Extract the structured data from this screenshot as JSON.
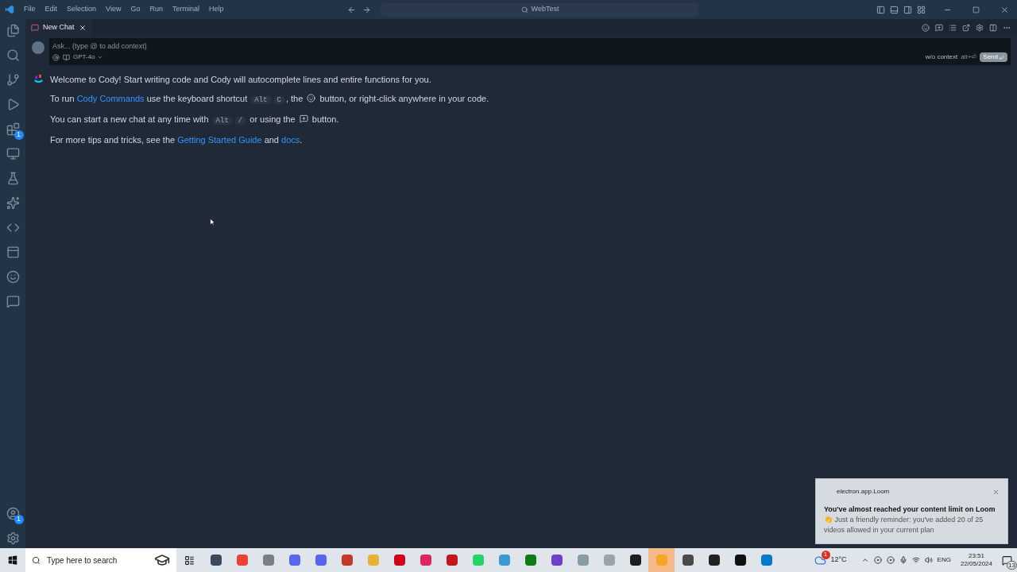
{
  "menu": [
    "File",
    "Edit",
    "Selection",
    "View",
    "Go",
    "Run",
    "Terminal",
    "Help"
  ],
  "command_center": {
    "placeholder": "WebTest"
  },
  "activity_bar": {
    "extensions_badge": "1",
    "accounts_badge": "1"
  },
  "tabs": [
    {
      "label": "New Chat",
      "selected": true
    }
  ],
  "chat_input": {
    "placeholder": "Ask... (type @ to add context)",
    "model": "GPT-4o",
    "context_hint": "w/o context",
    "shortcut": "alt+⏎",
    "send": "Send"
  },
  "messages": [
    {
      "segments": [
        {
          "kind": "text",
          "text": "Welcome to Cody! Start writing code and Cody will autocomplete lines and entire functions for you."
        }
      ]
    },
    {
      "segments": [
        {
          "kind": "text",
          "text": "To run "
        },
        {
          "kind": "link",
          "text": "Cody Commands"
        },
        {
          "kind": "text",
          "text": " use the keyboard shortcut "
        },
        {
          "kind": "key",
          "text": "Alt"
        },
        {
          "kind": "key",
          "text": "C"
        },
        {
          "kind": "text",
          "text": ", the "
        },
        {
          "kind": "icon"
        },
        {
          "kind": "text",
          "text": " button, or right-click anywhere in your code."
        }
      ]
    },
    {
      "segments": [
        {
          "kind": "text",
          "text": "You can start a new chat at any time with "
        },
        {
          "kind": "key",
          "text": "Alt"
        },
        {
          "kind": "key",
          "text": "/"
        },
        {
          "kind": "text",
          "text": " or using the "
        },
        {
          "kind": "icon"
        },
        {
          "kind": "text",
          "text": " button."
        }
      ]
    },
    {
      "segments": [
        {
          "kind": "text",
          "text": "For more tips and tricks, see the "
        },
        {
          "kind": "link",
          "text": "Getting Started Guide"
        },
        {
          "kind": "text",
          "text": " and "
        },
        {
          "kind": "link",
          "text": "docs"
        },
        {
          "kind": "text",
          "text": "."
        }
      ]
    }
  ],
  "notification": {
    "app": "electron.app.Loom",
    "title": "You've almost reached your content limit on Loom",
    "body": "👏 Just a friendly reminder: you've added 20 of 25 videos allowed in your current plan"
  },
  "taskbar": {
    "search_placeholder": "Type here to search",
    "apps": [
      {
        "color": "#3b4a5a",
        "active": false
      },
      {
        "color": "#ea4335",
        "active": false
      },
      {
        "color": "#7a7f86",
        "active": false
      },
      {
        "color": "#5865f2",
        "active": false
      },
      {
        "color": "#5865f2",
        "active": false
      },
      {
        "color": "#c0392b",
        "active": false
      },
      {
        "color": "#e8b13a",
        "active": false
      },
      {
        "color": "#d0021b",
        "active": false
      },
      {
        "color": "#e0245e",
        "active": false
      },
      {
        "color": "#c4161c",
        "active": false
      },
      {
        "color": "#25d366",
        "active": false
      },
      {
        "color": "#3d9ad1",
        "active": false
      },
      {
        "color": "#107c10",
        "active": false
      },
      {
        "color": "#6e40c9",
        "active": false
      },
      {
        "color": "#8a9ba8",
        "active": false
      },
      {
        "color": "#9aa4ad",
        "active": false
      },
      {
        "color": "#1e1e1e",
        "active": false
      },
      {
        "color": "#f5a623",
        "active": true
      },
      {
        "color": "#4a4a4a",
        "active": false
      },
      {
        "color": "#222222",
        "active": false
      },
      {
        "color": "#111111",
        "active": false
      },
      {
        "color": "#007acc",
        "active": false
      }
    ],
    "weather_badge": "1",
    "temperature": "12°C",
    "language": "ENG",
    "time": "23:51",
    "date": "22/05/2024",
    "notifications": "13"
  }
}
